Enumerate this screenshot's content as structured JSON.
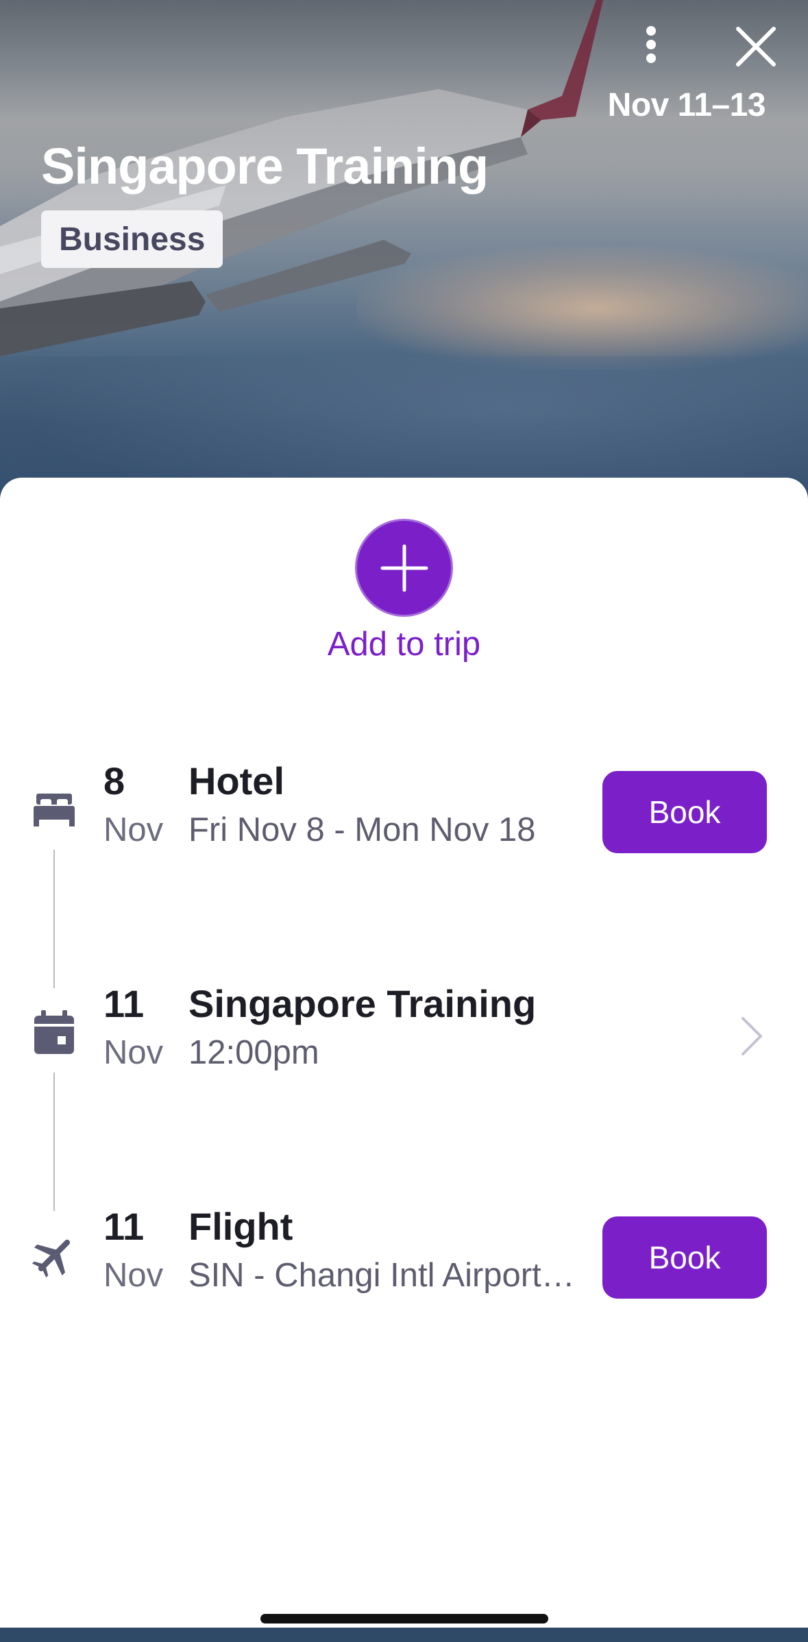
{
  "header": {
    "date_range": "Nov 11–13",
    "title": "Singapore Training",
    "badge": "Business",
    "more_icon": "more-vertical-icon",
    "close_icon": "close-icon"
  },
  "add": {
    "label": "Add to trip",
    "icon": "plus-icon"
  },
  "items": [
    {
      "day": "8",
      "month": "Nov",
      "title": "Hotel",
      "subtitle": "Fri Nov 8 - Mon Nov 18",
      "icon": "bed-icon",
      "action": "Book"
    },
    {
      "day": "11",
      "month": "Nov",
      "title": "Singapore Training",
      "subtitle": "12:00pm",
      "icon": "calendar-icon",
      "action": "chevron-right-icon"
    },
    {
      "day": "11",
      "month": "Nov",
      "title": "Flight",
      "subtitle": "SIN - Changi Intl Airport…",
      "icon": "airplane-icon",
      "action": "Book"
    }
  ],
  "colors": {
    "accent": "#7b1fc9",
    "text_primary": "#1d1d26",
    "text_secondary": "#5d5d6f",
    "icon": "#5b5b73"
  }
}
